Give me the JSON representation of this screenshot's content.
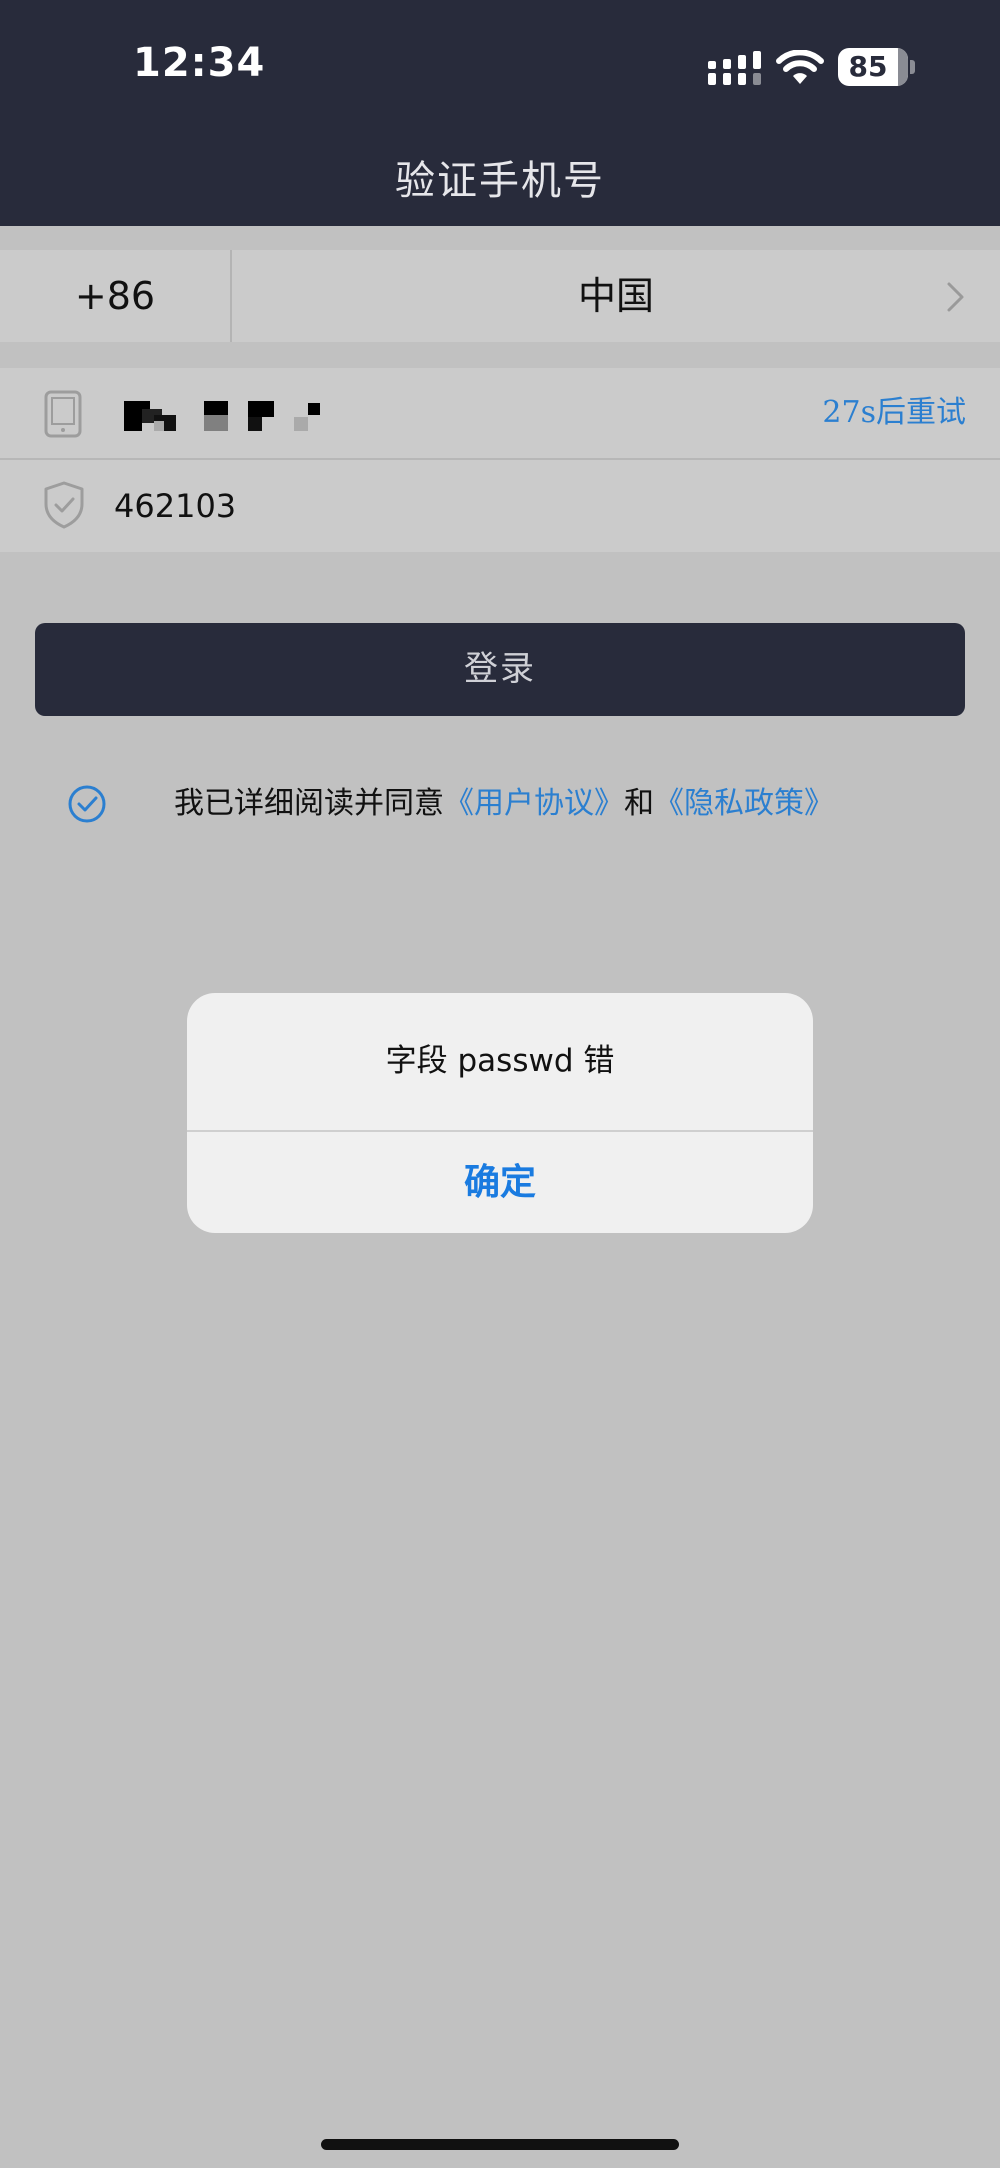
{
  "status_bar": {
    "time": "12:34",
    "battery_level": "85"
  },
  "header": {
    "title": "验证手机号"
  },
  "country": {
    "dial_code": "+86",
    "name": "中国"
  },
  "phone": {
    "retry_label": "27s后重试"
  },
  "verification": {
    "code_value": "462103"
  },
  "login_button": {
    "label": "登录"
  },
  "agreement": {
    "prefix": "我已详细阅读并同意",
    "user_agreement": "《用户协议》",
    "conjunction": "和",
    "privacy_policy": "《隐私政策》"
  },
  "alert": {
    "message": "字段 passwd 错",
    "confirm_label": "确定"
  },
  "colors": {
    "header_bg": "#282b3b",
    "link": "#2b7fd0",
    "alert_button": "#1a7be0",
    "page_bg": "#c1c1c1"
  }
}
